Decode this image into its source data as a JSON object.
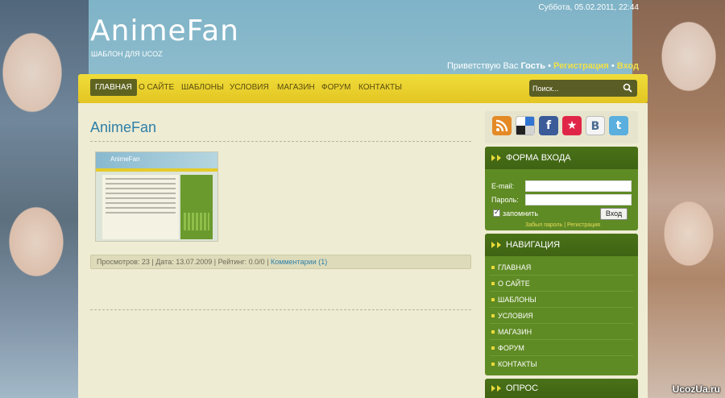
{
  "header": {
    "datetime": "Суббота, 05.02.2011, 22:44",
    "logo": "AnimeFan",
    "slogan": "ШАБЛОН ДЛЯ UCOZ",
    "greeting": "Приветствую Вас",
    "guest": "Гость",
    "register": "Регистрация",
    "login": "Вход",
    "separator": "•"
  },
  "nav": {
    "items": [
      "ГЛАВНАЯ",
      "О САЙТЕ",
      "ШАБЛОНЫ",
      "УСЛОВИЯ",
      "МАГАЗИН",
      "ФОРУМ",
      "КОНТАКТЫ"
    ],
    "search_placeholder": "Поиск..."
  },
  "post": {
    "title": "AnimeFan",
    "thumb_title": "AnimeFan",
    "views_label": "Просмотров:",
    "views": "23",
    "date_label": "Дата:",
    "date": "13.07.2009",
    "rating_label": "Рейтинг:",
    "rating": "0.0/0",
    "comments_link": "Комментарии (1)"
  },
  "social": {
    "icons": [
      "rss-icon",
      "delicious-icon",
      "facebook-icon",
      "star-icon",
      "vkontakte-icon",
      "twitter-icon"
    ],
    "vk_letter": "B",
    "fb_letter": "f",
    "tw_letter": "t",
    "star_glyph": "★"
  },
  "login_block": {
    "title": "ФОРМА ВХОДА",
    "email_label": "E-mail:",
    "password_label": "Пароль:",
    "remember": "запомнить",
    "submit": "Вход",
    "forgot": "Забыл пароль",
    "links_sep": "|",
    "register": "Регистрация"
  },
  "navigation_block": {
    "title": "НАВИГАЦИЯ",
    "items": [
      "ГЛАВНАЯ",
      "О САЙТЕ",
      "ШАБЛОНЫ",
      "УСЛОВИЯ",
      "МАГАЗИН",
      "ФОРУМ",
      "КОНТАКТЫ"
    ]
  },
  "poll_block": {
    "title": "ОПРОС"
  },
  "watermark": "UcozUa.ru",
  "colors": {
    "nav_yellow": "#e3c522",
    "sidebar_green": "#5f8b24",
    "link_blue": "#2d7fa8",
    "content_bg": "#efecd4"
  }
}
